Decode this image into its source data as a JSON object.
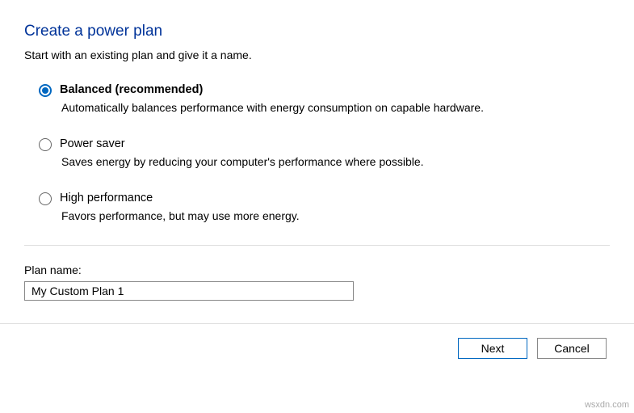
{
  "title": "Create a power plan",
  "subtitle": "Start with an existing plan and give it a name.",
  "options": [
    {
      "label": "Balanced (recommended)",
      "desc": "Automatically balances performance with energy consumption on capable hardware.",
      "selected": true
    },
    {
      "label": "Power saver",
      "desc": "Saves energy by reducing your computer's performance where possible.",
      "selected": false
    },
    {
      "label": "High performance",
      "desc": "Favors performance, but may use more energy.",
      "selected": false
    }
  ],
  "planName": {
    "label": "Plan name:",
    "value": "My Custom Plan 1"
  },
  "buttons": {
    "next": "Next",
    "cancel": "Cancel"
  },
  "watermark": "wsxdn.com"
}
